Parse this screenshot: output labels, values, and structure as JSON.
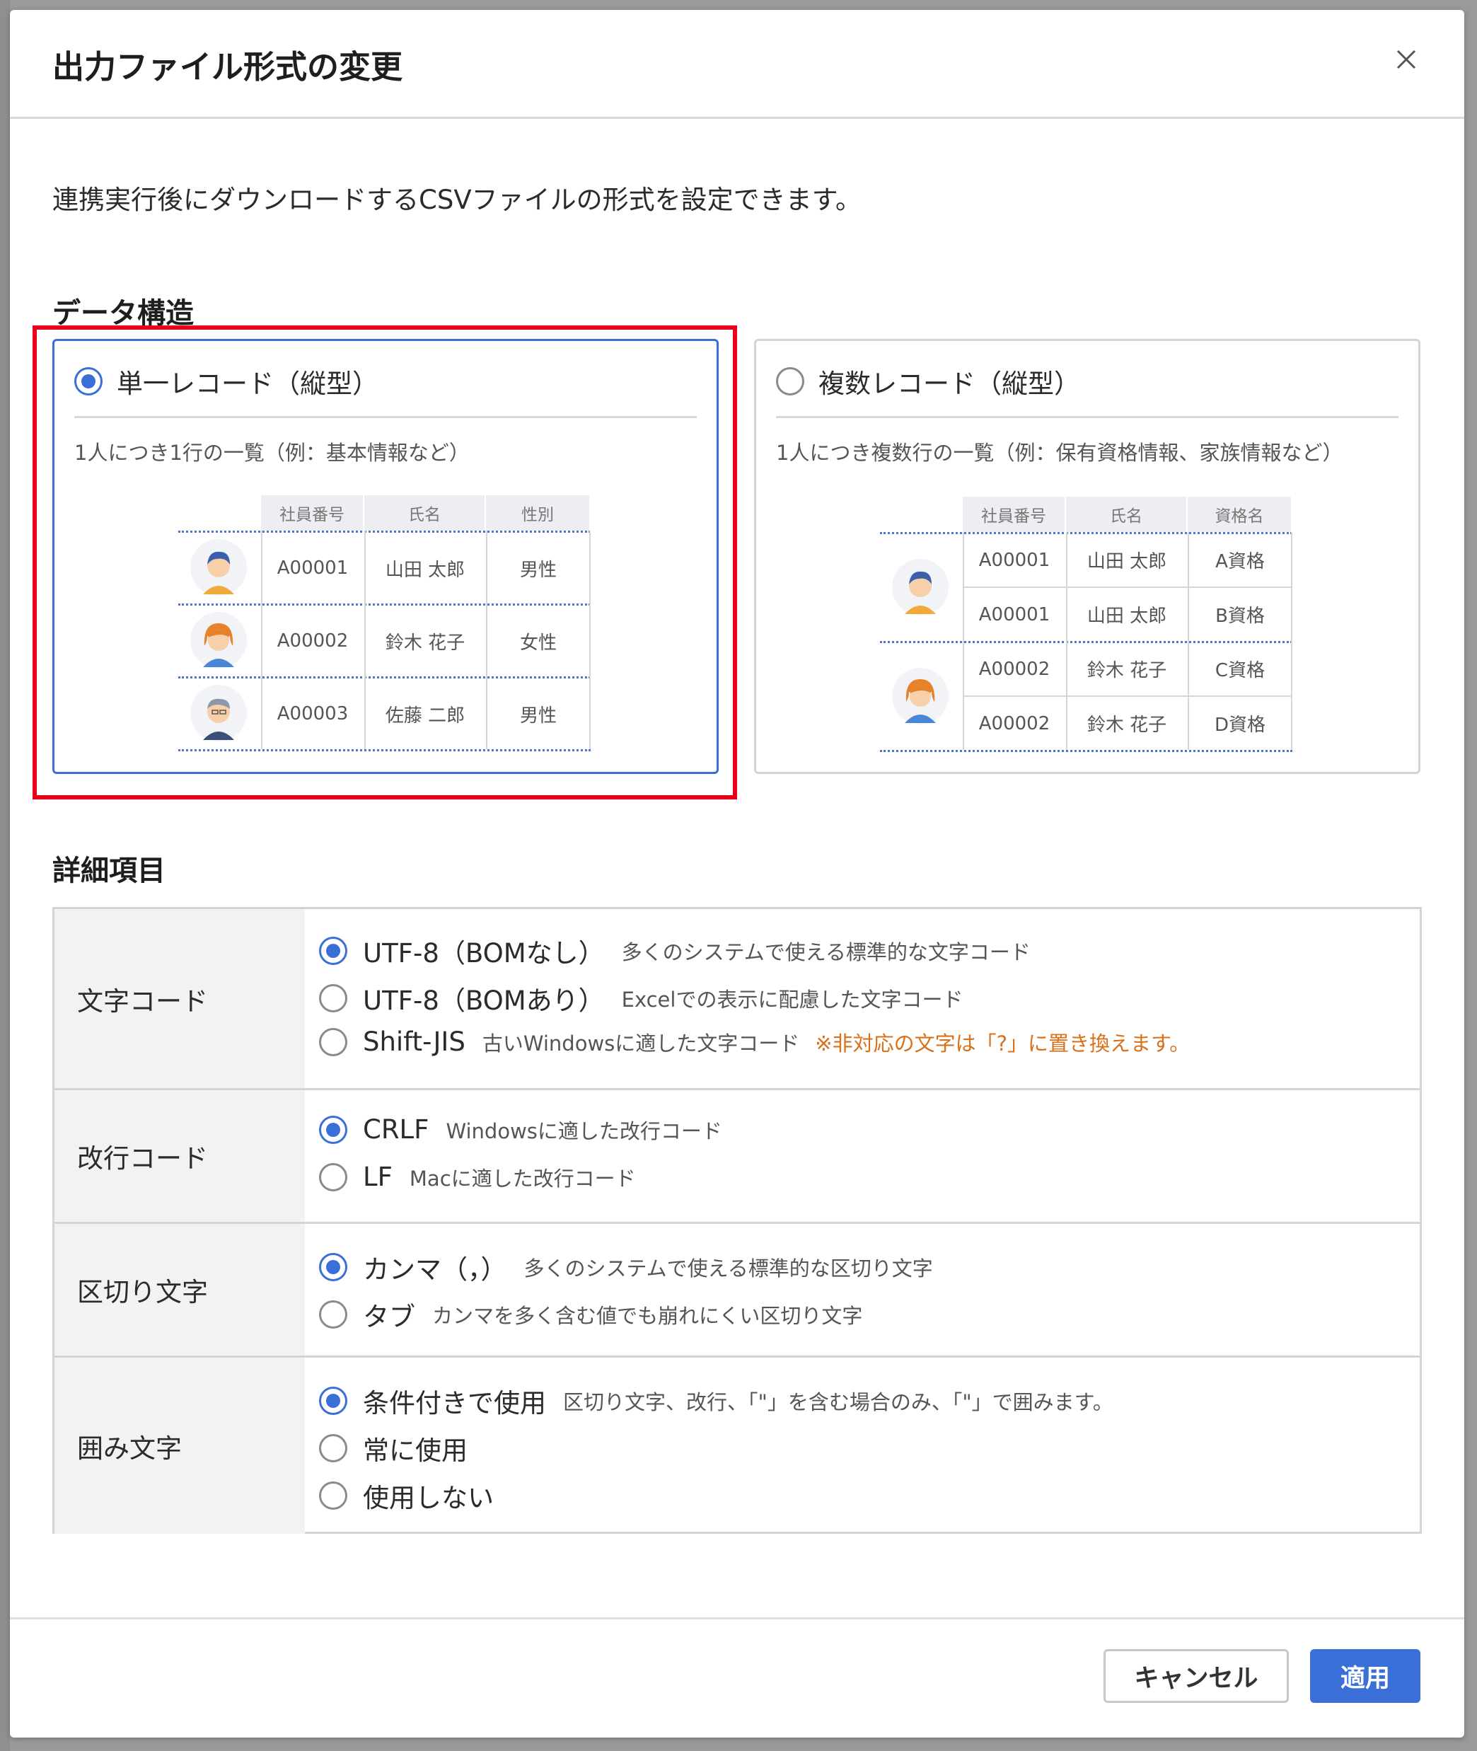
{
  "dialog": {
    "title": "出力ファイル形式の変更",
    "description": "連携実行後にダウンロードするCSVファイルの形式を設定できます。"
  },
  "data_structure": {
    "heading": "データ構造",
    "single": {
      "label": "単一レコード（縦型）",
      "selected": true,
      "subtitle": "1人につき1行の一覧（例：基本情報など）",
      "columns": [
        "社員番号",
        "氏名",
        "性別"
      ],
      "rows": [
        [
          "A00001",
          "山田 太郎",
          "男性"
        ],
        [
          "A00002",
          "鈴木 花子",
          "女性"
        ],
        [
          "A00003",
          "佐藤 二郎",
          "男性"
        ]
      ]
    },
    "multiple": {
      "label": "複数レコード（縦型）",
      "selected": false,
      "subtitle": "1人につき複数行の一覧（例：保有資格情報、家族情報など）",
      "columns": [
        "社員番号",
        "氏名",
        "資格名"
      ],
      "rows": [
        [
          "A00001",
          "山田 太郎",
          "A資格"
        ],
        [
          "A00001",
          "山田 太郎",
          "B資格"
        ],
        [
          "A00002",
          "鈴木 花子",
          "C資格"
        ],
        [
          "A00002",
          "鈴木 花子",
          "D資格"
        ]
      ]
    }
  },
  "details": {
    "heading": "詳細項目",
    "rows": [
      {
        "label": "文字コード",
        "options": [
          {
            "label": "UTF-8（BOMなし）",
            "desc": "多くのシステムで使える標準的な文字コード",
            "checked": true
          },
          {
            "label": "UTF-8（BOMあり）",
            "desc": "Excelでの表示に配慮した文字コード",
            "checked": false
          },
          {
            "label": "Shift-JIS",
            "desc": "古いWindowsに適した文字コード",
            "warning": "※非対応の文字は「?」に置き換えます。",
            "checked": false
          }
        ]
      },
      {
        "label": "改行コード",
        "options": [
          {
            "label": "CRLF",
            "desc": "Windowsに適した改行コード",
            "checked": true
          },
          {
            "label": "LF",
            "desc": "Macに適した改行コード",
            "checked": false
          }
        ]
      },
      {
        "label": "区切り文字",
        "options": [
          {
            "label": "カンマ（，）",
            "desc": "多くのシステムで使える標準的な区切り文字",
            "checked": true
          },
          {
            "label": "タブ",
            "desc": "カンマを多く含む値でも崩れにくい区切り文字",
            "checked": false
          }
        ]
      },
      {
        "label": "囲み文字",
        "options": [
          {
            "label": "条件付きで使用",
            "desc": "区切り文字、改行、「\"」を含む場合のみ、「\"」で囲みます。",
            "checked": true
          },
          {
            "label": "常に使用",
            "desc": "",
            "checked": false
          },
          {
            "label": "使用しない",
            "desc": "",
            "checked": false
          }
        ]
      }
    ]
  },
  "footer": {
    "cancel": "キャンセル",
    "apply": "適用"
  },
  "colors": {
    "accent": "#3a6fd8",
    "highlight": "#e8001a",
    "warning": "#d9701a"
  }
}
